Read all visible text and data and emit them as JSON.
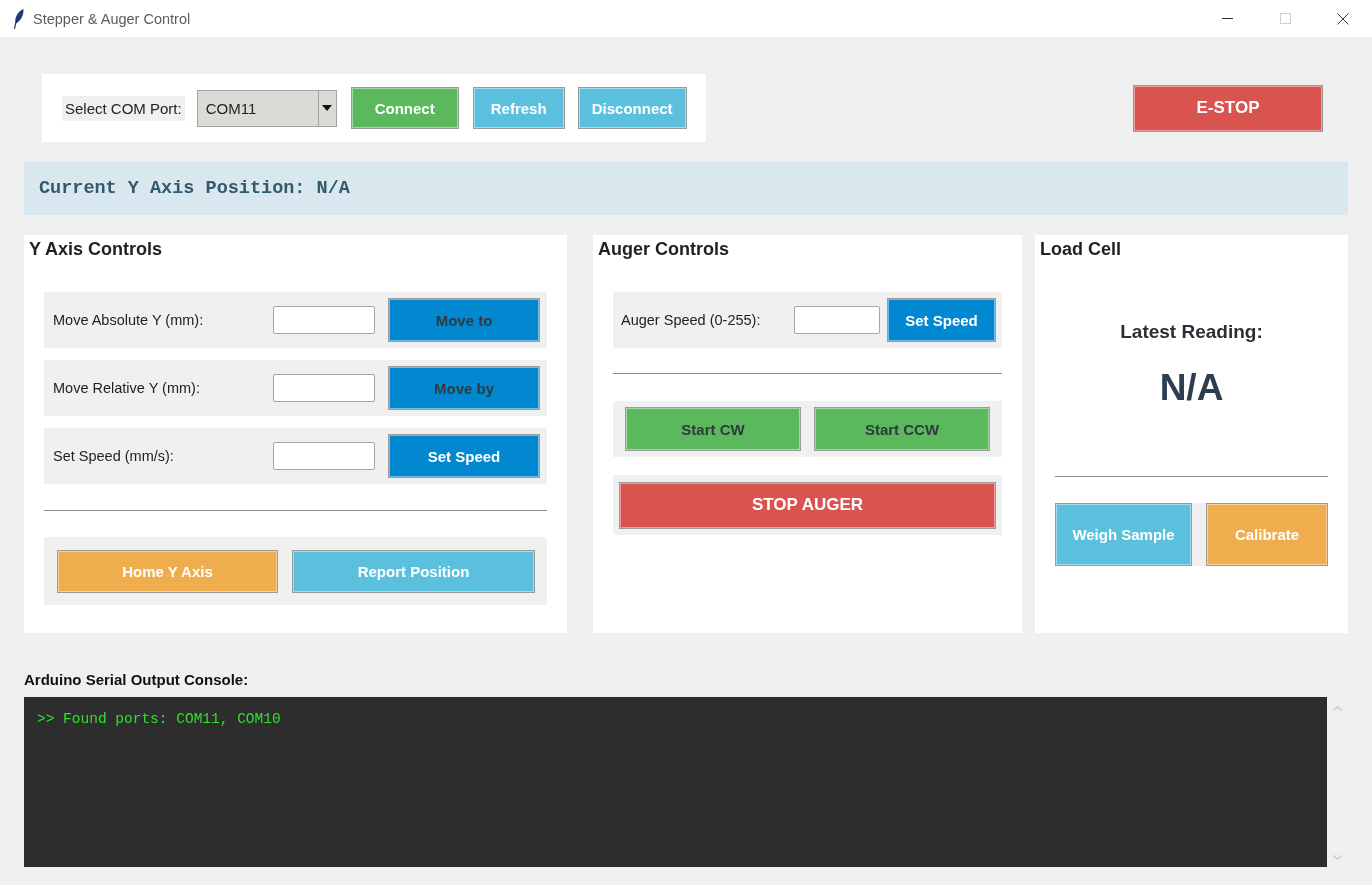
{
  "window": {
    "title": "Stepper & Auger Control",
    "controls": [
      {
        "kind": "minimize",
        "disabled": false
      },
      {
        "kind": "maximize",
        "disabled": true
      },
      {
        "kind": "close",
        "disabled": false
      }
    ]
  },
  "connection": {
    "label": "Select COM Port:",
    "port": {
      "value": "COM11"
    },
    "buttons": [
      {
        "label": "Connect",
        "kind": "success",
        "disabled": false
      },
      {
        "label": "Refresh",
        "kind": "info",
        "disabled": false
      },
      {
        "label": "Disconnect",
        "kind": "info",
        "disabled": false
      }
    ]
  },
  "estop": {
    "label": "E-STOP",
    "kind": "danger",
    "disabled": false
  },
  "position_banner": {
    "text": "Current Y Axis Position: N/A"
  },
  "y_axis": {
    "title": "Y Axis Controls",
    "rows": [
      {
        "label": "Move Absolute Y (mm):",
        "button": {
          "label": "Move to",
          "kind": "primary",
          "disabled": true
        }
      },
      {
        "label": "Move Relative Y (mm):",
        "button": {
          "label": "Move by",
          "kind": "primary",
          "disabled": true
        }
      },
      {
        "label": "Set Speed (mm/s):",
        "button": {
          "label": "Set Speed",
          "kind": "primary",
          "disabled": false
        }
      }
    ],
    "actions": [
      {
        "label": "Home Y Axis",
        "kind": "warning",
        "disabled": false
      },
      {
        "label": "Report Position",
        "kind": "info",
        "disabled": false
      }
    ]
  },
  "auger": {
    "title": "Auger Controls",
    "speed": {
      "label": "Auger Speed (0-255):",
      "button": {
        "label": "Set Speed",
        "kind": "primary",
        "disabled": false
      }
    },
    "direction_buttons": [
      {
        "label": "Start CW",
        "kind": "success",
        "disabled": true
      },
      {
        "label": "Start CCW",
        "kind": "success",
        "disabled": true
      }
    ],
    "stop_button": {
      "label": "STOP AUGER",
      "kind": "danger",
      "disabled": false
    }
  },
  "load_cell": {
    "title": "Load Cell",
    "reading_label": "Latest Reading:",
    "reading_value": "N/A",
    "buttons": [
      {
        "label": "Weigh Sample",
        "kind": "info",
        "disabled": false
      },
      {
        "label": "Calibrate",
        "kind": "warning",
        "disabled": false
      }
    ]
  },
  "console": {
    "label": "Arduino Serial Output Console:",
    "lines": [
      ">> Found ports: COM11, COM10"
    ]
  }
}
